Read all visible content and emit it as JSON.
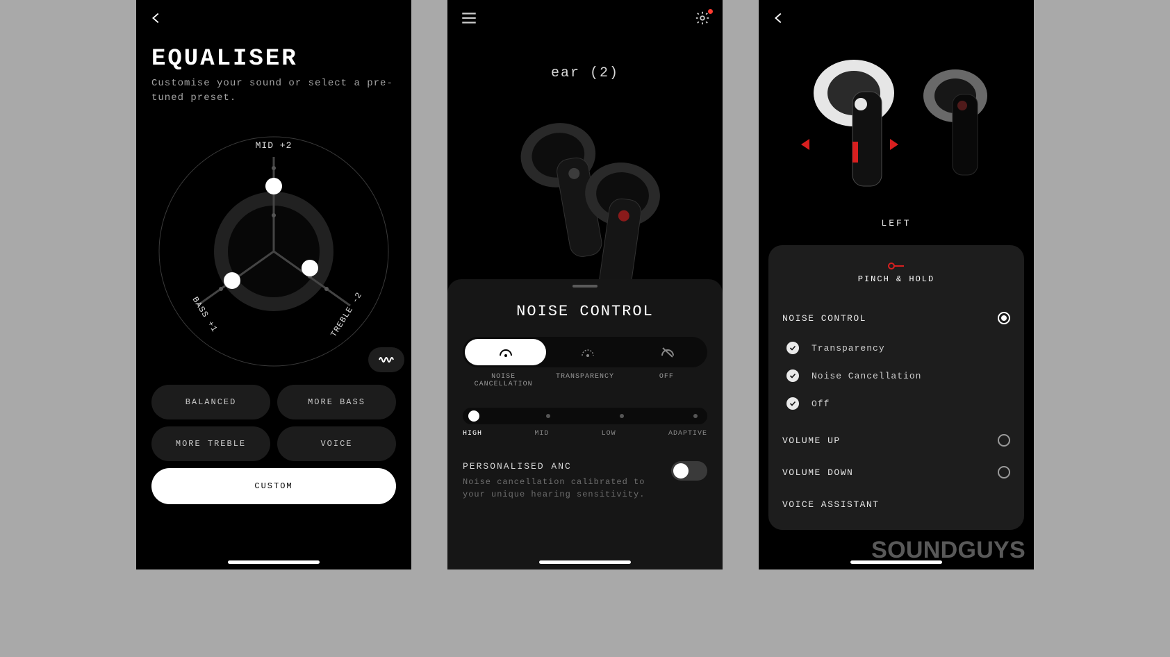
{
  "panel1": {
    "title": "EQUALISER",
    "subtitle": "Customise your sound or select a pre-tuned preset.",
    "axes": {
      "mid": "MID +2",
      "bass": "BASS +1",
      "treble": "TREBLE -2"
    },
    "presets": [
      "BALANCED",
      "MORE BASS",
      "MORE TREBLE",
      "VOICE"
    ],
    "custom": "CUSTOM"
  },
  "panel2": {
    "product": "ear (2)",
    "sheet_title": "NOISE CONTROL",
    "segments": [
      "NOISE CANCELLATION",
      "TRANSPARENCY",
      "OFF"
    ],
    "selected_segment": 0,
    "anc_levels": [
      "HIGH",
      "MID",
      "LOW",
      "ADAPTIVE"
    ],
    "selected_level": 0,
    "panc_title": "PERSONALISED ANC",
    "panc_desc": "Noise cancellation calibrated to your unique hearing sensitivity.",
    "panc_on": false
  },
  "panel3": {
    "side": "LEFT",
    "gesture": "PINCH & HOLD",
    "option_group": "NOISE CONTROL",
    "sub_options": [
      "Transparency",
      "Noise Cancellation",
      "Off"
    ],
    "other_options": [
      "VOLUME UP",
      "VOLUME DOWN",
      "VOICE ASSISTANT"
    ],
    "selected": "NOISE CONTROL"
  },
  "watermark": "SOUNDGUYS",
  "chart_data": {
    "type": "radar",
    "title": "Equaliser custom curve",
    "axes": [
      "MID",
      "BASS",
      "TREBLE"
    ],
    "range": [
      -5,
      5
    ],
    "series": [
      {
        "name": "Custom",
        "values": [
          2,
          1,
          -2
        ]
      }
    ]
  }
}
